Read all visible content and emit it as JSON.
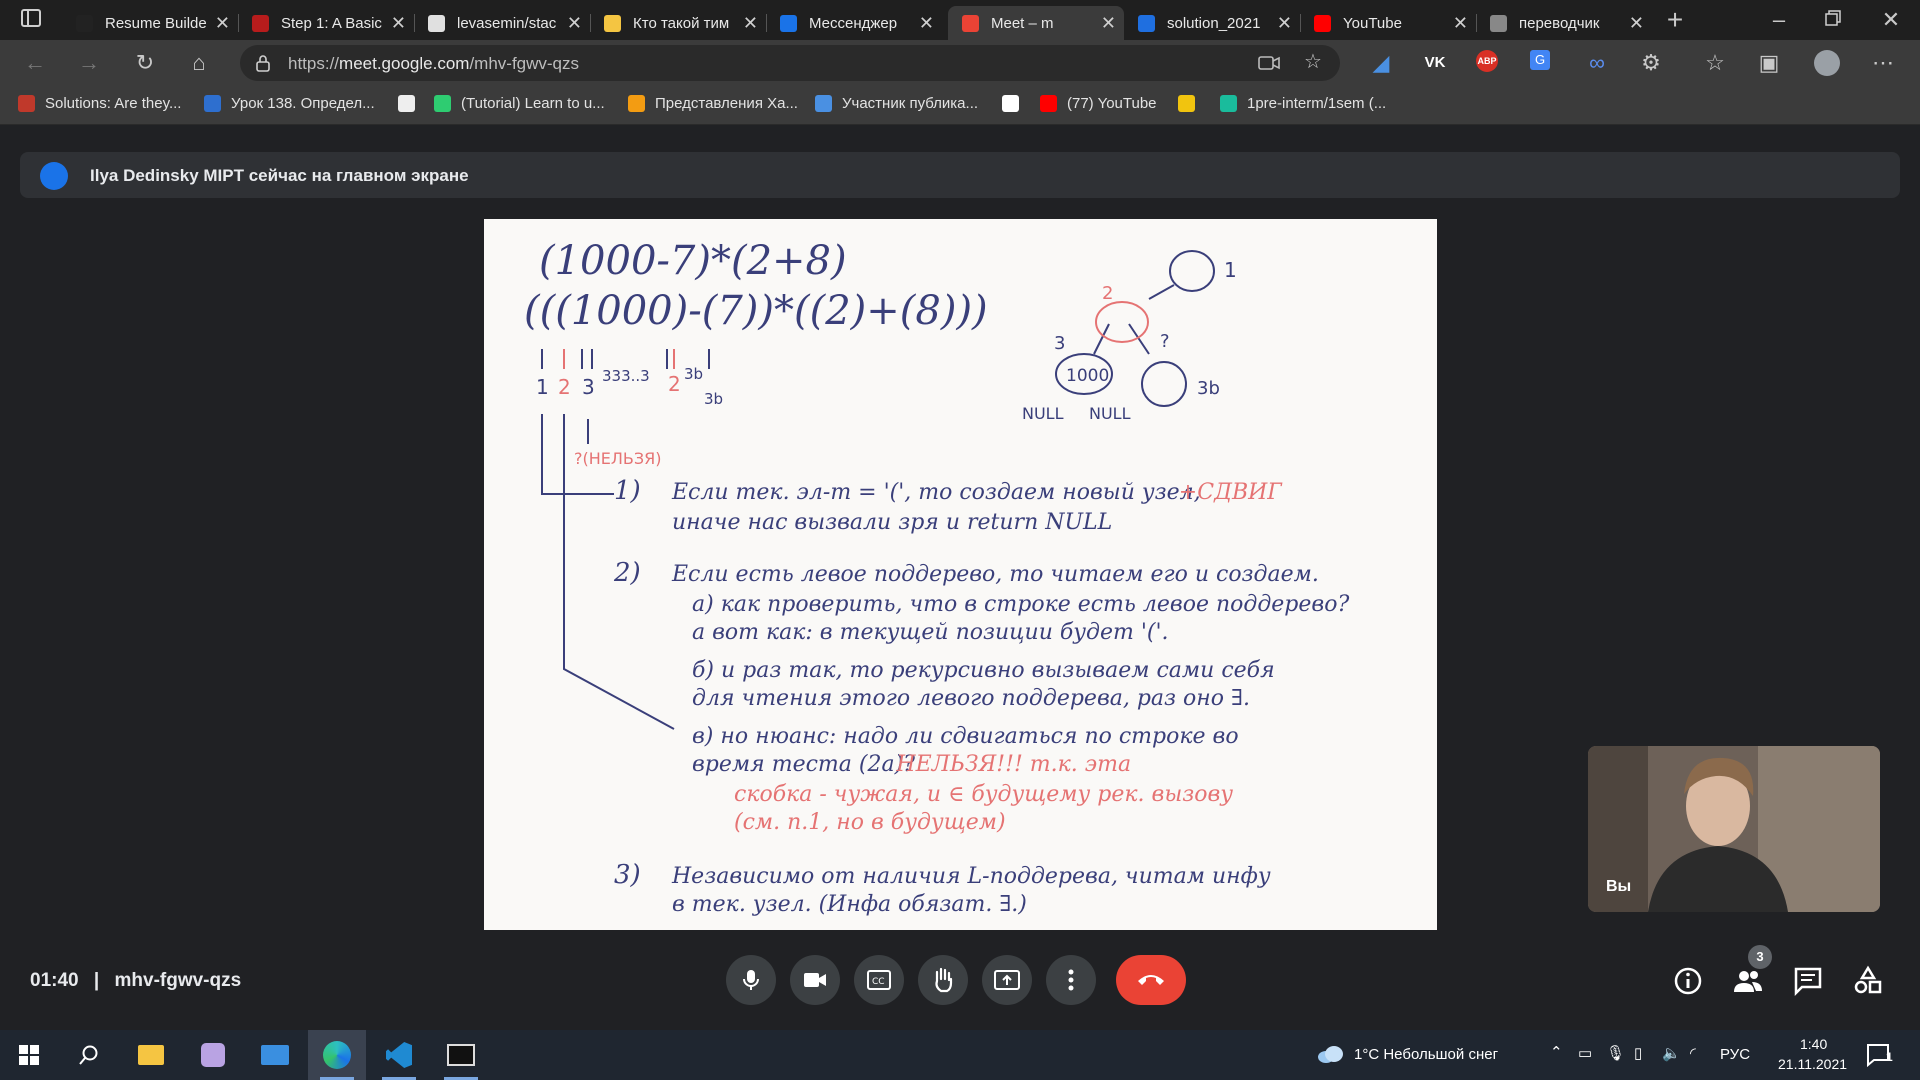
{
  "tabs": [
    {
      "title": "Resume Builde",
      "fav": "#222"
    },
    {
      "title": "Step 1: A Basic",
      "fav": "#b71c1c"
    },
    {
      "title": "levasemin/stac",
      "fav": "#e0e0e0"
    },
    {
      "title": "Кто такой тим",
      "fav": "#f4c542"
    },
    {
      "title": "Мессенджер",
      "fav": "#1a73e8"
    },
    {
      "title": "Meet – m",
      "fav": "#ea4335"
    },
    {
      "title": "solution_2021",
      "fav": "#1f6fe0"
    },
    {
      "title": "YouTube",
      "fav": "#ff0000"
    },
    {
      "title": "переводчик",
      "fav": "#888"
    }
  ],
  "address": {
    "prefix": "https://",
    "domain": "meet.google.com",
    "path": "/mhv-fgwv-qzs"
  },
  "bookmarks": [
    {
      "label": "Solutions: Are they...",
      "color": "#c0392b"
    },
    {
      "label": "Урок 138. Определ...",
      "color": "#2e6fcf"
    },
    {
      "label": "",
      "color": "#eeeeee"
    },
    {
      "label": "(Tutorial) Learn to u...",
      "color": "#2ecc71"
    },
    {
      "label": "Представления Ха...",
      "color": "#f39c12"
    },
    {
      "label": "Участник публика...",
      "color": "#4a90e2"
    },
    {
      "label": "",
      "color": "#ffffff"
    },
    {
      "label": "(77) YouTube",
      "color": "#ff0000"
    },
    {
      "label": "",
      "color": "#f1c40f"
    },
    {
      "label": "1pre-interm/1sem (...",
      "color": "#1abc9c"
    }
  ],
  "banner": {
    "text": "Ilya Dedinsky MIPT сейчас на главном экране"
  },
  "self_label": "Вы",
  "meeting": {
    "time": "01:40",
    "separator": "|",
    "code": "mhv-fgwv-qzs"
  },
  "people_count": "3",
  "taskbar": {
    "weather": "1°C  Небольшой снег",
    "lang": "РУС",
    "time": "1:40",
    "date": "21.11.2021",
    "notif_count": "1"
  },
  "whiteboard": {
    "expr1": "(1000-7)*(2+8)",
    "expr2": "(((1000)-(7))*((2)+(8)))",
    "idx": [
      "1",
      "2",
      "3",
      "333..3",
      "2",
      "3b",
      "3b"
    ],
    "nelzya_small": "?(НЕЛЬЗЯ)",
    "tree_nodes": [
      "1",
      "2",
      "3",
      "1000",
      "3b",
      "?",
      "NULL",
      "NULL"
    ],
    "lines": [
      {
        "n": "1)",
        "t": "Если тек. эл-т = '(', то создаем новый узел,",
        "r": "+СДВИГ"
      },
      {
        "n": "",
        "t": "иначе нас вызвали зря и return NULL",
        "r": ""
      },
      {
        "n": "2)",
        "t": "Если есть левое поддерево, то читаем его и создаем.",
        "r": ""
      },
      {
        "n": "",
        "t": "а) как проверить, что в строке есть левое поддерево?",
        "r": ""
      },
      {
        "n": "",
        "t": "а вот как: в текущей позиции будет '('.",
        "r": ""
      },
      {
        "n": "",
        "t": "б) и раз так, то рекурсивно вызываем сами себя",
        "r": ""
      },
      {
        "n": "",
        "t": "для чтения этого левого поддерева, раз оно ∃.",
        "r": ""
      },
      {
        "n": "",
        "t": "в) но нюанс: надо ли сдвигаться по строке во",
        "r": ""
      },
      {
        "n": "",
        "t": "время теста (2а)?",
        "r": "НЕЛЬЗЯ!!! т.к. эта"
      },
      {
        "n": "",
        "t": "",
        "r": "скобка - чужая, и ∈ будущему рек. вызову"
      },
      {
        "n": "",
        "t": "",
        "r": "(см. п.1, но в будущем)"
      },
      {
        "n": "3)",
        "t": "Независимо от наличия L-поддерева, читам инфу",
        "r": ""
      },
      {
        "n": "",
        "t": "в тек. узел. (Инфа обязат. ∃.)",
        "r": ""
      }
    ]
  }
}
